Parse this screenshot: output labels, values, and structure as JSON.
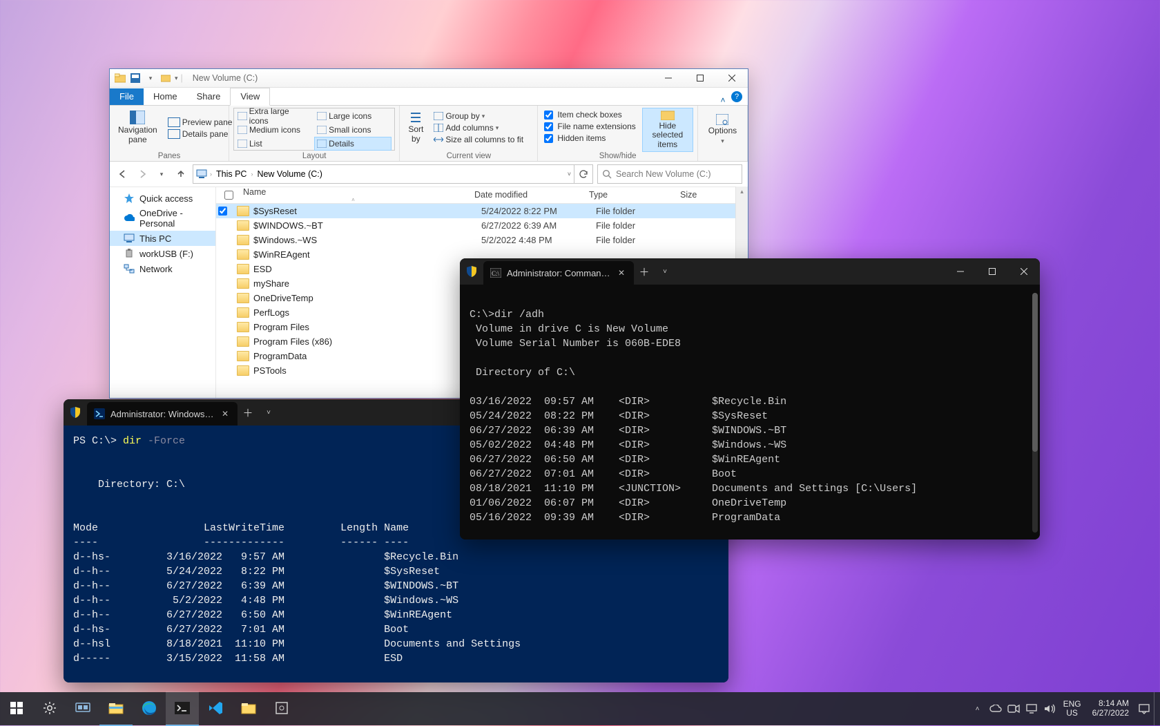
{
  "explorer": {
    "title": "New Volume (C:)",
    "tabs": {
      "file": "File",
      "home": "Home",
      "share": "Share",
      "view": "View"
    },
    "ribbon": {
      "panes_label": "Panes",
      "navpane": "Navigation\npane",
      "preview": "Preview pane",
      "details_pane": "Details pane",
      "layout_label": "Layout",
      "layout_opts": [
        "Extra large icons",
        "Large icons",
        "Medium icons",
        "Small icons",
        "List",
        "Details"
      ],
      "layout_selected": "Details",
      "currentview_label": "Current view",
      "sortby": "Sort\nby",
      "groupby": "Group by",
      "addcols": "Add columns",
      "sizeall": "Size all columns to fit",
      "showhide_label": "Show/hide",
      "itemcheck": "Item check boxes",
      "fileext": "File name extensions",
      "hiddenitems": "Hidden items",
      "hidesel": "Hide selected\nitems",
      "options": "Options"
    },
    "breadcrumb": [
      "This PC",
      "New Volume (C:)"
    ],
    "search_placeholder": "Search New Volume (C:)",
    "tree": [
      {
        "label": "Quick access",
        "icon": "star",
        "color": "#3b9de3"
      },
      {
        "label": "OneDrive - Personal",
        "icon": "cloud",
        "color": "#0078d4"
      },
      {
        "label": "This PC",
        "icon": "monitor",
        "color": "#3b6fa7",
        "selected": true
      },
      {
        "label": "workUSB (F:)",
        "icon": "usb",
        "color": "#7a7a7a"
      },
      {
        "label": "Network",
        "icon": "network",
        "color": "#3b6fa7"
      }
    ],
    "columns": {
      "name": "Name",
      "date": "Date modified",
      "type": "Type",
      "size": "Size"
    },
    "rows": [
      {
        "name": "$SysReset",
        "date": "5/24/2022 8:22 PM",
        "type": "File folder",
        "selected": true,
        "checked": true
      },
      {
        "name": "$WINDOWS.~BT",
        "date": "6/27/2022 6:39 AM",
        "type": "File folder"
      },
      {
        "name": "$Windows.~WS",
        "date": "5/2/2022 4:48 PM",
        "type": "File folder"
      },
      {
        "name": "$WinREAgent",
        "date": "",
        "type": ""
      },
      {
        "name": "ESD",
        "date": "",
        "type": ""
      },
      {
        "name": "myShare",
        "date": "",
        "type": ""
      },
      {
        "name": "OneDriveTemp",
        "date": "",
        "type": ""
      },
      {
        "name": "PerfLogs",
        "date": "",
        "type": ""
      },
      {
        "name": "Program Files",
        "date": "",
        "type": ""
      },
      {
        "name": "Program Files (x86)",
        "date": "",
        "type": ""
      },
      {
        "name": "ProgramData",
        "date": "",
        "type": ""
      },
      {
        "name": "PSTools",
        "date": "",
        "type": ""
      }
    ]
  },
  "powershell": {
    "tab_title": "Administrator: Windows Powe",
    "prompt": "PS C:\\> ",
    "command_cmd": "dir",
    "command_arg": " -Force",
    "dir_header": "    Directory: C:\\",
    "col_header": "Mode                 LastWriteTime         Length Name",
    "col_rule": "----                 -------------         ------ ----",
    "rows": [
      "d--hs-         3/16/2022   9:57 AM                $Recycle.Bin",
      "d--h--         5/24/2022   8:22 PM                $SysReset",
      "d--h--         6/27/2022   6:39 AM                $WINDOWS.~BT",
      "d--h--          5/2/2022   4:48 PM                $Windows.~WS",
      "d--h--         6/27/2022   6:50 AM                $WinREAgent",
      "d--hs-         6/27/2022   7:01 AM                Boot",
      "d--hsl         8/18/2021  11:10 PM                Documents and Settings",
      "d-----         3/15/2022  11:58 AM                ESD"
    ]
  },
  "cmd": {
    "tab_title": "Administrator: Command Prom",
    "lines": [
      "C:\\>dir /adh",
      " Volume in drive C is New Volume",
      " Volume Serial Number is 060B-EDE8",
      "",
      " Directory of C:\\",
      "",
      "03/16/2022  09:57 AM    <DIR>          $Recycle.Bin",
      "05/24/2022  08:22 PM    <DIR>          $SysReset",
      "06/27/2022  06:39 AM    <DIR>          $WINDOWS.~BT",
      "05/02/2022  04:48 PM    <DIR>          $Windows.~WS",
      "06/27/2022  06:50 AM    <DIR>          $WinREAgent",
      "06/27/2022  07:01 AM    <DIR>          Boot",
      "08/18/2021  11:10 PM    <JUNCTION>     Documents and Settings [C:\\Users]",
      "01/06/2022  06:07 PM    <DIR>          OneDriveTemp",
      "05/16/2022  09:39 AM    <DIR>          ProgramData"
    ]
  },
  "taskbar": {
    "lang1": "ENG",
    "lang2": "US",
    "time": "8:14 AM",
    "date": "6/27/2022"
  }
}
